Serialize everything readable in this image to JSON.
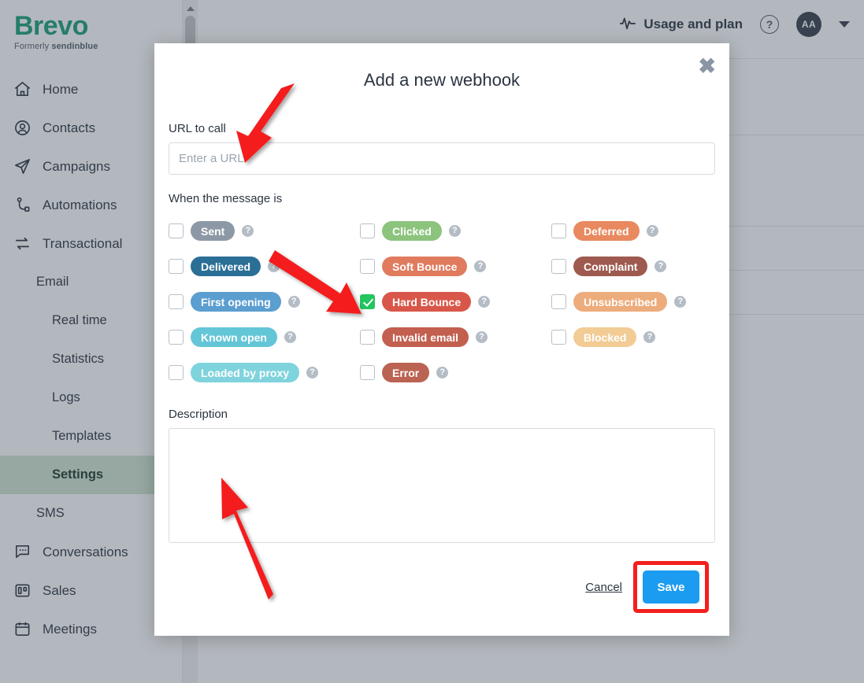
{
  "brand": {
    "name": "Brevo",
    "formerly_prefix": "Formerly",
    "formerly_name": "sendinblue"
  },
  "sidebar": {
    "items": [
      {
        "label": "Home",
        "icon": "home-icon",
        "level": 0,
        "active": false
      },
      {
        "label": "Contacts",
        "icon": "contacts-icon",
        "level": 0,
        "active": false
      },
      {
        "label": "Campaigns",
        "icon": "campaigns-icon",
        "level": 0,
        "active": false
      },
      {
        "label": "Automations",
        "icon": "automations-icon",
        "level": 0,
        "active": false
      },
      {
        "label": "Transactional",
        "icon": "transactional-icon",
        "level": 0,
        "active": false
      },
      {
        "label": "Email",
        "icon": "",
        "level": 1,
        "active": false
      },
      {
        "label": "Real time",
        "icon": "",
        "level": 2,
        "active": false
      },
      {
        "label": "Statistics",
        "icon": "",
        "level": 2,
        "active": false
      },
      {
        "label": "Logs",
        "icon": "",
        "level": 2,
        "active": false
      },
      {
        "label": "Templates",
        "icon": "",
        "level": 2,
        "active": false
      },
      {
        "label": "Settings",
        "icon": "",
        "level": 2,
        "active": true
      },
      {
        "label": "SMS",
        "icon": "",
        "level": 1,
        "active": false
      },
      {
        "label": "Conversations",
        "icon": "conversations-icon",
        "level": 0,
        "active": false
      },
      {
        "label": "Sales",
        "icon": "sales-icon",
        "level": 0,
        "active": false
      },
      {
        "label": "Meetings",
        "icon": "meetings-icon",
        "level": 0,
        "active": false
      }
    ]
  },
  "topbar": {
    "usage_label": "Usage and plan",
    "help_label": "?",
    "avatar_initials": "AA"
  },
  "modal": {
    "title": "Add a new webhook",
    "close_label": "✖",
    "url_field": {
      "label": "URL to call",
      "value": "",
      "placeholder": "Enter a URL"
    },
    "events_label": "When the message is",
    "events": [
      {
        "label": "Sent",
        "checked": false,
        "color": "#8d98a6",
        "help": "?"
      },
      {
        "label": "Delivered",
        "checked": false,
        "color": "#2b6e96",
        "help": "?"
      },
      {
        "label": "First opening",
        "checked": false,
        "color": "#5b9ed0",
        "help": "?"
      },
      {
        "label": "Known open",
        "checked": false,
        "color": "#63c6d6",
        "help": "?"
      },
      {
        "label": "Loaded by proxy",
        "checked": false,
        "color": "#7fd3dd",
        "help": "?"
      },
      {
        "label": "Clicked",
        "checked": false,
        "color": "#8cc47e",
        "help": "?"
      },
      {
        "label": "Soft Bounce",
        "checked": false,
        "color": "#e07b5e",
        "help": "?"
      },
      {
        "label": "Hard Bounce",
        "checked": true,
        "color": "#d9574a",
        "help": "?"
      },
      {
        "label": "Invalid email",
        "checked": false,
        "color": "#c25f4f",
        "help": "?"
      },
      {
        "label": "Error",
        "checked": false,
        "color": "#bb6352",
        "help": "?"
      },
      {
        "label": "Deferred",
        "checked": false,
        "color": "#e8895f",
        "help": "?"
      },
      {
        "label": "Complaint",
        "checked": false,
        "color": "#9e5a4e",
        "help": "?"
      },
      {
        "label": "Unsubscribed",
        "checked": false,
        "color": "#edac7c",
        "help": "?"
      },
      {
        "label": "Blocked",
        "checked": false,
        "color": "#f2cc94",
        "help": "?"
      }
    ],
    "description_field": {
      "label": "Description",
      "value": "",
      "placeholder": ""
    },
    "cancel_label": "Cancel",
    "save_label": "Save"
  },
  "colors": {
    "brand_green": "#0b996e",
    "save_blue": "#1b9cf0",
    "checked_green": "#22c55e",
    "annotation_red": "#f41f1f",
    "active_nav_bg": "#cde3cd"
  }
}
